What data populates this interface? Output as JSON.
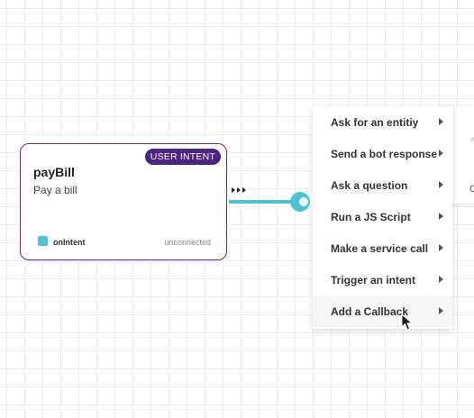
{
  "node": {
    "badge": "USER INTENT",
    "title": "payBill",
    "description": "Pay a bill",
    "port_label": "onIntent",
    "status": "unconnected"
  },
  "side_panel": {
    "partial_a": "a",
    "partial_b": "C"
  },
  "menu": {
    "items": [
      {
        "label": "Ask for an entitiy"
      },
      {
        "label": "Send a bot response"
      },
      {
        "label": "Ask a question"
      },
      {
        "label": "Run a JS Script"
      },
      {
        "label": "Make a service call"
      },
      {
        "label": "Trigger an intent"
      },
      {
        "label": "Add a Callback"
      }
    ],
    "hovered_index": 6
  },
  "colors": {
    "node_border": "#5b2d8a",
    "badge_bg": "#4c2482",
    "connector": "#4ec3d8",
    "port": "#4ec3d8"
  },
  "icons": {
    "submenu": "chevron-right-icon",
    "connector_handle": "connection-handle-icon",
    "flow_arrows": "triple-arrow-icon",
    "pointer": "mouse-pointer-icon"
  }
}
